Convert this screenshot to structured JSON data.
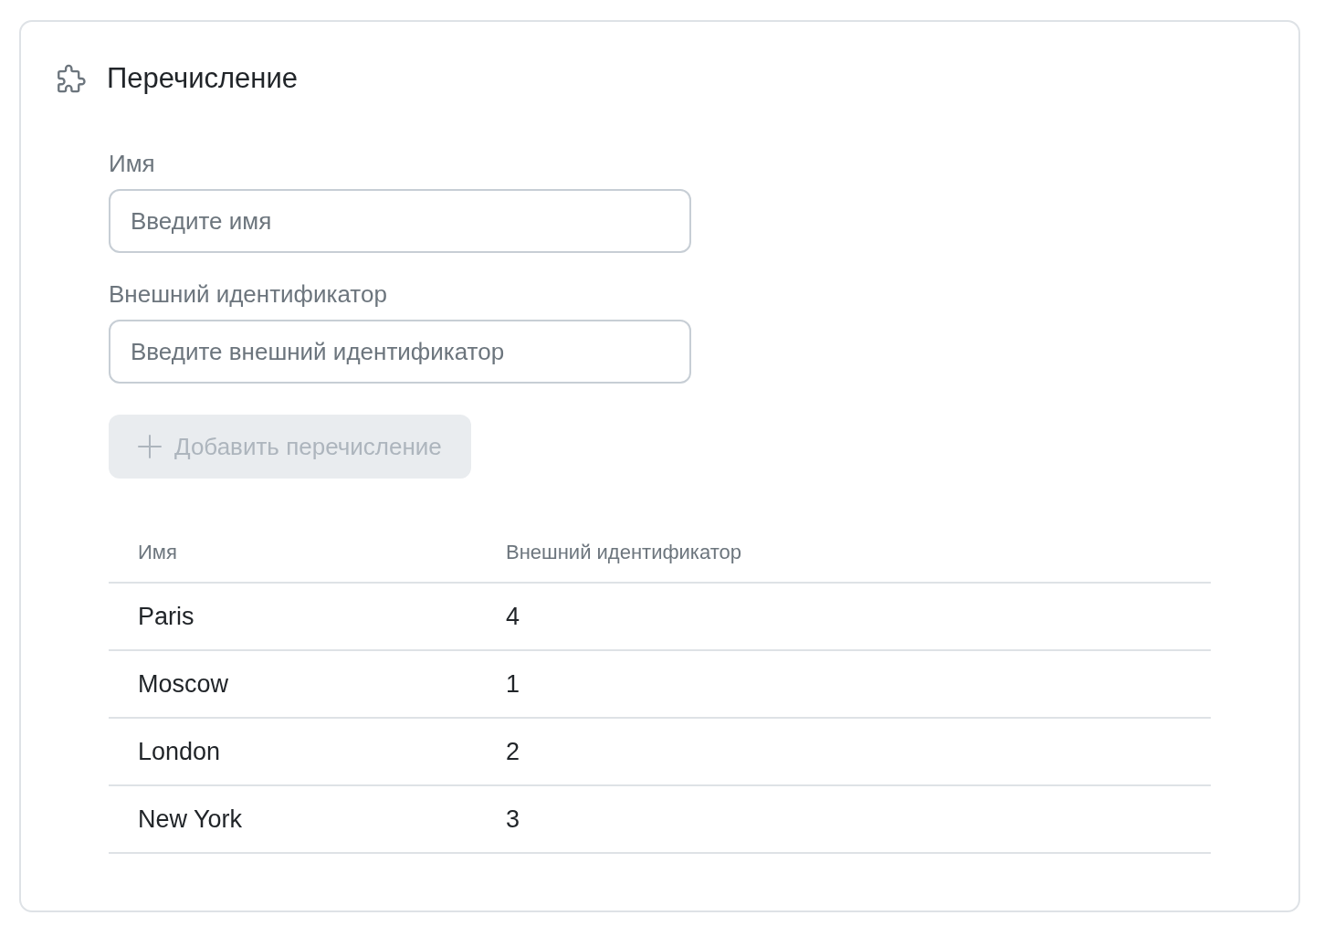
{
  "card": {
    "title": "Перечисление"
  },
  "form": {
    "fields": [
      {
        "label": "Имя",
        "placeholder": "Введите имя"
      },
      {
        "label": "Внешний идентификатор",
        "placeholder": "Введите внешний идентификатор"
      }
    ],
    "add_button": {
      "label": "Добавить перечисление",
      "disabled": true
    }
  },
  "table": {
    "columns": [
      "Имя",
      "Внешний идентификатор"
    ],
    "rows": [
      [
        "Paris",
        "4"
      ],
      [
        "Moscow",
        "1"
      ],
      [
        "London",
        "2"
      ],
      [
        "New York",
        "3"
      ]
    ]
  }
}
